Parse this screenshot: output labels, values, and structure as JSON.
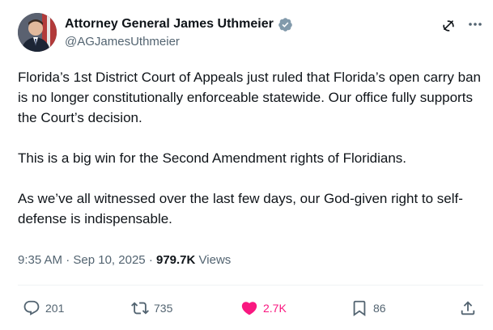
{
  "author": {
    "name": "Attorney General James Uthmeier",
    "handle": "@AGJamesUthmeier"
  },
  "body_paragraphs": [
    "Florida’s 1st District Court of Appeals just ruled that Florida’s open carry ban is no longer constitutionally enforceable statewide. Our office fully supports the Court’s decision.",
    "This is a big win for the Second Amendment rights of Floridians.",
    "As we’ve all witnessed over the last few days, our God-given right to self-defense is indispensable."
  ],
  "meta": {
    "time": "9:35 AM",
    "date": "Sep 10, 2025",
    "views_count": "979.7K",
    "views_label": "Views"
  },
  "actions": {
    "replies": "201",
    "reposts": "735",
    "likes": "2.7K",
    "bookmarks": "86"
  },
  "colors": {
    "verified": "#829aab",
    "like": "#f91880",
    "secondary_text": "#536471"
  },
  "icons": [
    "verified-badge-icon",
    "grok-icon",
    "more-icon",
    "reply-icon",
    "repost-icon",
    "heart-icon",
    "bookmark-icon",
    "share-icon"
  ]
}
